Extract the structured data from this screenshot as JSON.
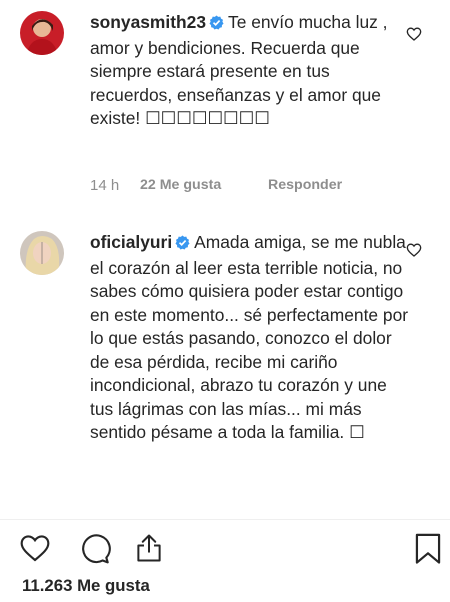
{
  "comments": [
    {
      "username": "sonyasmith23",
      "text": "Te envío mucha luz , amor y bendiciones. Recuerda que siempre estará presente en tus recuerdos, enseñanzas y el amor que existe! ☐☐☐☐☐☐☐☐",
      "time": "14 h",
      "likes": "22 Me gusta",
      "reply": "Responder"
    },
    {
      "username": "oficialyuri",
      "text": "Amada amiga, se me nubla el corazón al leer esta terrible noticia, no sabes cómo quisiera poder estar contigo en este momento... sé perfectamente por lo que estás pasando, conozco el dolor de esa pérdida, recibe mi cariño incondicional, abrazo tu corazón y une tus lágrimas con las mías... mi más sentido pésame a toda la familia. ☐"
    }
  ],
  "post": {
    "like_count": "11.263 Me gusta"
  },
  "colors": {
    "verified": "#3897f0",
    "meta_text": "#8e8e8e"
  },
  "icons": {
    "comment_like": "heart-outline-icon",
    "verified": "verified-badge-icon",
    "like": "heart-icon",
    "comment": "comment-bubble-icon",
    "share": "share-icon",
    "save": "bookmark-icon"
  }
}
